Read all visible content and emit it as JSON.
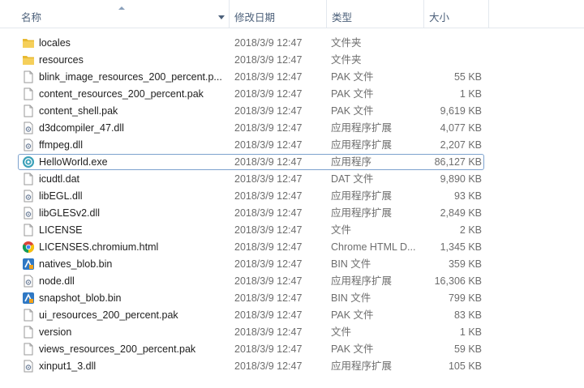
{
  "columns": {
    "name": "名称",
    "date": "修改日期",
    "type": "类型",
    "size": "大小"
  },
  "files": [
    {
      "name": "locales",
      "date": "2018/3/9 12:47",
      "type": "文件夹",
      "size": "",
      "icon": "folder-icon"
    },
    {
      "name": "resources",
      "date": "2018/3/9 12:47",
      "type": "文件夹",
      "size": "",
      "icon": "folder-icon"
    },
    {
      "name": "blink_image_resources_200_percent.p...",
      "date": "2018/3/9 12:47",
      "type": "PAK 文件",
      "size": "55 KB",
      "icon": "file-icon"
    },
    {
      "name": "content_resources_200_percent.pak",
      "date": "2018/3/9 12:47",
      "type": "PAK 文件",
      "size": "1 KB",
      "icon": "file-icon"
    },
    {
      "name": "content_shell.pak",
      "date": "2018/3/9 12:47",
      "type": "PAK 文件",
      "size": "9,619 KB",
      "icon": "file-icon"
    },
    {
      "name": "d3dcompiler_47.dll",
      "date": "2018/3/9 12:47",
      "type": "应用程序扩展",
      "size": "4,077 KB",
      "icon": "dll-icon"
    },
    {
      "name": "ffmpeg.dll",
      "date": "2018/3/9 12:47",
      "type": "应用程序扩展",
      "size": "2,207 KB",
      "icon": "dll-icon"
    },
    {
      "name": "HelloWorld.exe",
      "date": "2018/3/9 12:47",
      "type": "应用程序",
      "size": "86,127 KB",
      "icon": "exe-icon"
    },
    {
      "name": "icudtl.dat",
      "date": "2018/3/9 12:47",
      "type": "DAT 文件",
      "size": "9,890 KB",
      "icon": "file-icon"
    },
    {
      "name": "libEGL.dll",
      "date": "2018/3/9 12:47",
      "type": "应用程序扩展",
      "size": "93 KB",
      "icon": "dll-icon"
    },
    {
      "name": "libGLESv2.dll",
      "date": "2018/3/9 12:47",
      "type": "应用程序扩展",
      "size": "2,849 KB",
      "icon": "dll-icon"
    },
    {
      "name": "LICENSE",
      "date": "2018/3/9 12:47",
      "type": "文件",
      "size": "2 KB",
      "icon": "file-icon"
    },
    {
      "name": "LICENSES.chromium.html",
      "date": "2018/3/9 12:47",
      "type": "Chrome HTML D...",
      "size": "1,345 KB",
      "icon": "chrome-icon"
    },
    {
      "name": "natives_blob.bin",
      "date": "2018/3/9 12:47",
      "type": "BIN 文件",
      "size": "359 KB",
      "icon": "bin-icon"
    },
    {
      "name": "node.dll",
      "date": "2018/3/9 12:47",
      "type": "应用程序扩展",
      "size": "16,306 KB",
      "icon": "dll-icon"
    },
    {
      "name": "snapshot_blob.bin",
      "date": "2018/3/9 12:47",
      "type": "BIN 文件",
      "size": "799 KB",
      "icon": "bin-icon"
    },
    {
      "name": "ui_resources_200_percent.pak",
      "date": "2018/3/9 12:47",
      "type": "PAK 文件",
      "size": "83 KB",
      "icon": "file-icon"
    },
    {
      "name": "version",
      "date": "2018/3/9 12:47",
      "type": "文件",
      "size": "1 KB",
      "icon": "file-icon"
    },
    {
      "name": "views_resources_200_percent.pak",
      "date": "2018/3/9 12:47",
      "type": "PAK 文件",
      "size": "59 KB",
      "icon": "file-icon"
    },
    {
      "name": "xinput1_3.dll",
      "date": "2018/3/9 12:47",
      "type": "应用程序扩展",
      "size": "105 KB",
      "icon": "dll-icon"
    }
  ],
  "selected_file": "HelloWorld.exe",
  "colors": {
    "folder": "#e8b931",
    "selection_border": "#7da2ce",
    "header_text": "#4c607a"
  }
}
